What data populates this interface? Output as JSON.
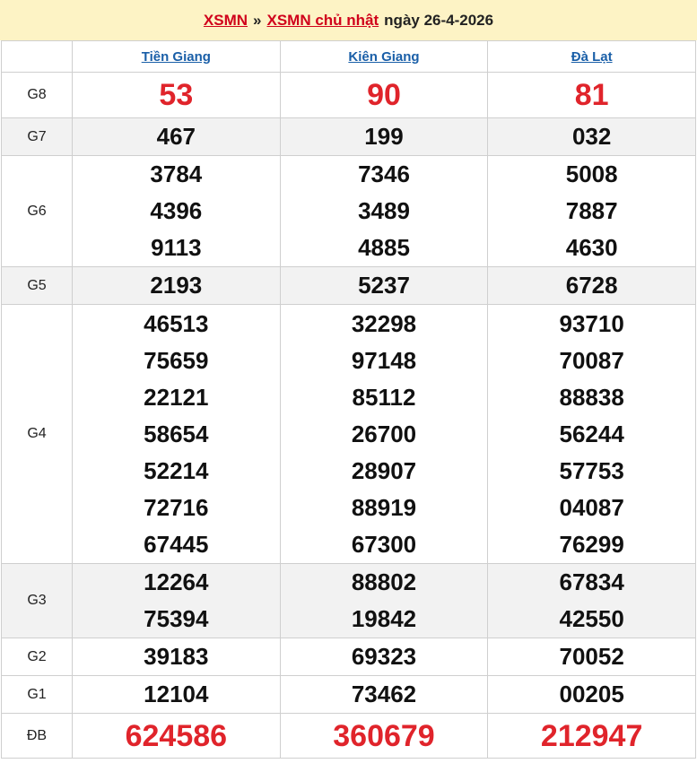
{
  "header": {
    "crumb_root": "XSMN",
    "separator": "»",
    "crumb_current": "XSMN chủ nhật",
    "date_text": "ngày 26-4-2026"
  },
  "columns": [
    "Tiền Giang",
    "Kiên Giang",
    "Đà Lạt"
  ],
  "colors": {
    "accent": "#e0242b",
    "link": "#1a5fa8",
    "header_bg": "#fdf3c5"
  },
  "rows": [
    {
      "prize": "G8",
      "style": "big",
      "values": [
        [
          "53"
        ],
        [
          "90"
        ],
        [
          "81"
        ]
      ]
    },
    {
      "prize": "G7",
      "style": "num",
      "values": [
        [
          "467"
        ],
        [
          "199"
        ],
        [
          "032"
        ]
      ]
    },
    {
      "prize": "G6",
      "style": "num",
      "values": [
        [
          "3784",
          "4396",
          "9113"
        ],
        [
          "7346",
          "3489",
          "4885"
        ],
        [
          "5008",
          "7887",
          "4630"
        ]
      ]
    },
    {
      "prize": "G5",
      "style": "num",
      "values": [
        [
          "2193"
        ],
        [
          "5237"
        ],
        [
          "6728"
        ]
      ]
    },
    {
      "prize": "G4",
      "style": "num",
      "values": [
        [
          "46513",
          "75659",
          "22121",
          "58654",
          "52214",
          "72716",
          "67445"
        ],
        [
          "32298",
          "97148",
          "85112",
          "26700",
          "28907",
          "88919",
          "67300"
        ],
        [
          "93710",
          "70087",
          "88838",
          "56244",
          "57753",
          "04087",
          "76299"
        ]
      ]
    },
    {
      "prize": "G3",
      "style": "num",
      "values": [
        [
          "12264",
          "75394"
        ],
        [
          "88802",
          "19842"
        ],
        [
          "67834",
          "42550"
        ]
      ]
    },
    {
      "prize": "G2",
      "style": "num",
      "values": [
        [
          "39183"
        ],
        [
          "69323"
        ],
        [
          "70052"
        ]
      ]
    },
    {
      "prize": "G1",
      "style": "num",
      "values": [
        [
          "12104"
        ],
        [
          "73462"
        ],
        [
          "00205"
        ]
      ]
    },
    {
      "prize": "ĐB",
      "style": "db",
      "values": [
        [
          "624586"
        ],
        [
          "360679"
        ],
        [
          "212947"
        ]
      ]
    }
  ]
}
